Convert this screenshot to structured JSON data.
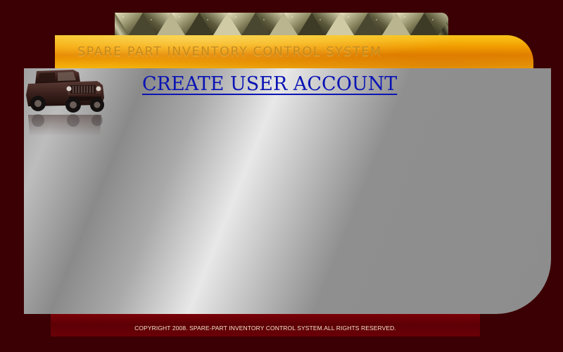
{
  "header": {
    "banner_title": "SPARE PART INVENTORY CONTROL SYSTEM"
  },
  "main": {
    "heading": "CREATE USER ACCOUNT"
  },
  "footer": {
    "copyright": "COPYRIGHT 2008. SPARE-PART INVENTORY CONTROL SYSTEM.ALL RIGHTS  RESERVED."
  },
  "colors": {
    "page_background": "#3b0004",
    "banner_gold": "#f6a500",
    "heading_link": "#0a14b4",
    "footer_background": "#5c0005",
    "footer_text": "#f3e0c8"
  },
  "icons": [
    "vehicle-image",
    "metal-strip-decoration"
  ]
}
